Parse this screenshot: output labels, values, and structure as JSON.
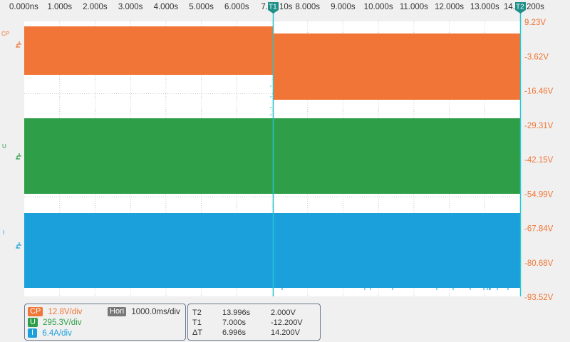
{
  "time_axis": {
    "labels": [
      "0.000ns",
      "1.000s",
      "2.000s",
      "3.000s",
      "4.000s",
      "5.000s",
      "6.000s",
      "7.",
      "8.000s",
      "9.000s",
      "10.000s",
      "11.000s",
      "12.000s",
      "13.000s",
      "14."
    ],
    "label_7_suffix": "10s",
    "label_14_suffix": "200s"
  },
  "voltage_axis": {
    "labels": [
      "9.23V",
      "-3.62V",
      "-16.46V",
      "-29.31V",
      "-42.15V",
      "-54.99V",
      "-67.84V",
      "-80.68V",
      "-93.52V"
    ]
  },
  "channels": [
    {
      "id": "CP",
      "label": "CP",
      "color": "#f07536",
      "scale": "12.8V/div"
    },
    {
      "id": "U",
      "label": "U",
      "color": "#2e9e48",
      "scale": "295.3V/div"
    },
    {
      "id": "I",
      "label": "I",
      "color": "#1ba0dc",
      "scale": "6.4A/div"
    }
  ],
  "horizontal": {
    "label": "Hori",
    "scale": "1000.0ms/div",
    "color": "#777777"
  },
  "cursors": {
    "t1_label": "T1",
    "t2_label": "T2",
    "color": "#26c6d0",
    "rows": [
      {
        "name": "T2",
        "time": "13.996s",
        "value": "2.000V"
      },
      {
        "name": "T1",
        "time": "7.000s",
        "value": "-12.200V"
      },
      {
        "name": "ΔT",
        "time": "6.996s",
        "value": "14.200V"
      }
    ]
  },
  "axis_color": "#f07536"
}
